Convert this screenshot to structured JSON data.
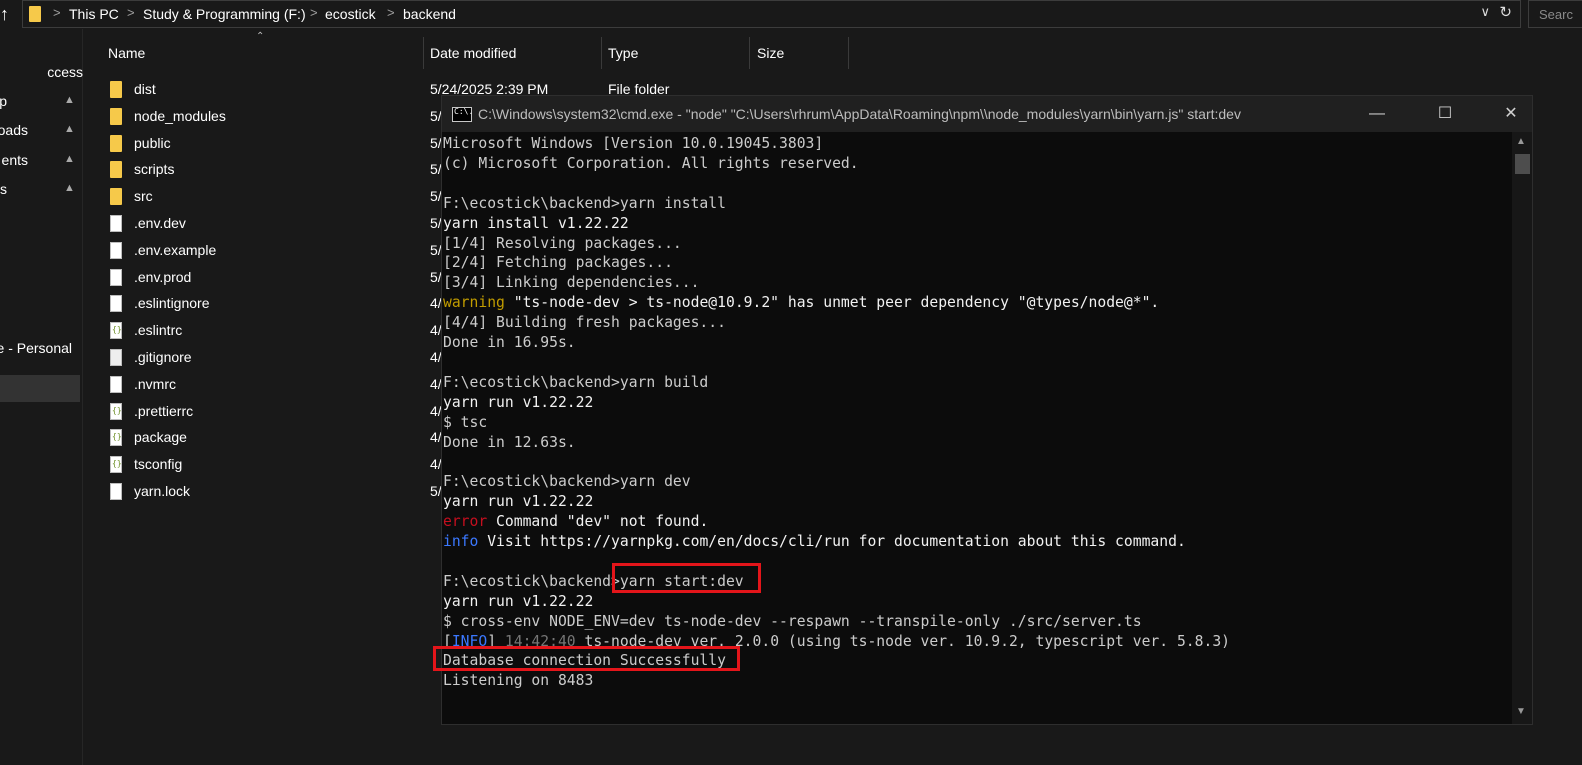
{
  "address": {
    "up_glyph": "↑",
    "crumbs": [
      "This PC",
      "Study & Programming (F:)",
      "ecostick",
      "backend"
    ],
    "separator": ">",
    "search_placeholder": "Searc"
  },
  "nav": {
    "items": [
      "ccess",
      "p",
      "oads",
      "ents",
      "s",
      "e - Personal"
    ]
  },
  "columns": {
    "name": "Name",
    "date": "Date modified",
    "type": "Type",
    "size": "Size"
  },
  "files": [
    {
      "name": "dist",
      "kind": "folder",
      "date": "5/24/2025 2:39 PM",
      "type": "File folder"
    },
    {
      "name": "node_modules",
      "kind": "folder",
      "date": "5/",
      "type": ""
    },
    {
      "name": "public",
      "kind": "folder",
      "date": "5/",
      "type": ""
    },
    {
      "name": "scripts",
      "kind": "folder",
      "date": "5/",
      "type": ""
    },
    {
      "name": "src",
      "kind": "folder",
      "date": "5/",
      "type": ""
    },
    {
      "name": ".env.dev",
      "kind": "file",
      "date": "5/",
      "type": ""
    },
    {
      "name": ".env.example",
      "kind": "file",
      "date": "5/",
      "type": ""
    },
    {
      "name": ".env.prod",
      "kind": "file",
      "date": "5/",
      "type": ""
    },
    {
      "name": ".eslintignore",
      "kind": "file",
      "date": "4/",
      "type": ""
    },
    {
      "name": ".eslintrc",
      "kind": "json",
      "date": "4/",
      "type": ""
    },
    {
      "name": ".gitignore",
      "kind": "text",
      "date": "4/",
      "type": ""
    },
    {
      "name": ".nvmrc",
      "kind": "file",
      "date": "4/",
      "type": ""
    },
    {
      "name": ".prettierrc",
      "kind": "json",
      "date": "4/",
      "type": ""
    },
    {
      "name": "package",
      "kind": "json",
      "date": "4/",
      "type": ""
    },
    {
      "name": "tsconfig",
      "kind": "json",
      "date": "4/",
      "type": ""
    },
    {
      "name": "yarn.lock",
      "kind": "file",
      "date": "5/",
      "type": ""
    }
  ],
  "cmd": {
    "icon_text": "C:\\.",
    "title": "C:\\Windows\\system32\\cmd.exe  - \"node\"   \"C:\\Users\\rhrum\\AppData\\Roaming\\npm\\\\node_modules\\yarn\\bin\\yarn.js\" start:dev",
    "minimize": "—",
    "maximize": "☐",
    "close": "✕",
    "lines": [
      [
        {
          "t": "Microsoft Windows [Version 10.0.19045.3803]",
          "c": ""
        }
      ],
      [
        {
          "t": "(c) Microsoft Corporation. All rights reserved.",
          "c": ""
        }
      ],
      [
        {
          "t": "",
          "c": ""
        }
      ],
      [
        {
          "t": "F:\\ecostick\\backend>yarn install",
          "c": ""
        }
      ],
      [
        {
          "t": "yarn install v1.22.22",
          "c": "c-white"
        }
      ],
      [
        {
          "t": "[1/4] Resolving packages...",
          "c": ""
        }
      ],
      [
        {
          "t": "[2/4] Fetching packages...",
          "c": ""
        }
      ],
      [
        {
          "t": "[3/4] Linking dependencies...",
          "c": ""
        }
      ],
      [
        {
          "t": "warning",
          "c": "c-warn"
        },
        {
          "t": " \"ts-node-dev > ts-node@10.9.2\" has unmet peer dependency \"@types/node@*\".",
          "c": "c-white"
        }
      ],
      [
        {
          "t": "[4/4] Building fresh packages...",
          "c": ""
        }
      ],
      [
        {
          "t": "Done in 16.95s.",
          "c": ""
        }
      ],
      [
        {
          "t": "",
          "c": ""
        }
      ],
      [
        {
          "t": "F:\\ecostick\\backend>yarn build",
          "c": ""
        }
      ],
      [
        {
          "t": "yarn run v1.22.22",
          "c": "c-white"
        }
      ],
      [
        {
          "t": "$ tsc",
          "c": ""
        }
      ],
      [
        {
          "t": "Done in 12.63s.",
          "c": ""
        }
      ],
      [
        {
          "t": "",
          "c": ""
        }
      ],
      [
        {
          "t": "F:\\ecostick\\backend>yarn dev",
          "c": ""
        }
      ],
      [
        {
          "t": "yarn run v1.22.22",
          "c": "c-white"
        }
      ],
      [
        {
          "t": "error",
          "c": "c-err"
        },
        {
          "t": " Command \"dev\" not found.",
          "c": "c-white"
        }
      ],
      [
        {
          "t": "info",
          "c": "c-info"
        },
        {
          "t": " Visit ",
          "c": "c-white"
        },
        {
          "t": "https://yarnpkg.com/en/docs/cli/run",
          "c": "c-white"
        },
        {
          "t": " for documentation about this command.",
          "c": "c-white"
        }
      ],
      [
        {
          "t": "",
          "c": ""
        }
      ],
      [
        {
          "t": "F:\\ecostick\\backend>yarn start:dev",
          "c": ""
        }
      ],
      [
        {
          "t": "yarn run v1.22.22",
          "c": "c-white"
        }
      ],
      [
        {
          "t": "$ cross-env NODE_ENV=dev ts-node-dev --respawn --transpile-only ./src/server.ts",
          "c": ""
        }
      ],
      [
        {
          "t": "[",
          "c": ""
        },
        {
          "t": "INFO",
          "c": "c-info"
        },
        {
          "t": "] ",
          "c": ""
        },
        {
          "t": "14:42:40",
          "c": "c-dim"
        },
        {
          "t": " ts-node-dev ver. 2.0.0 (using ts-node ver. 10.9.2, typescript ver. 5.8.3)",
          "c": ""
        }
      ],
      [
        {
          "t": "Database connection Successfully",
          "c": ""
        }
      ],
      [
        {
          "t": "Listening on 8483",
          "c": ""
        }
      ]
    ]
  },
  "colors": {
    "highlight": "#e4151a",
    "folder": "#f6c94a",
    "terminal_bg": "#0c0c0c"
  }
}
